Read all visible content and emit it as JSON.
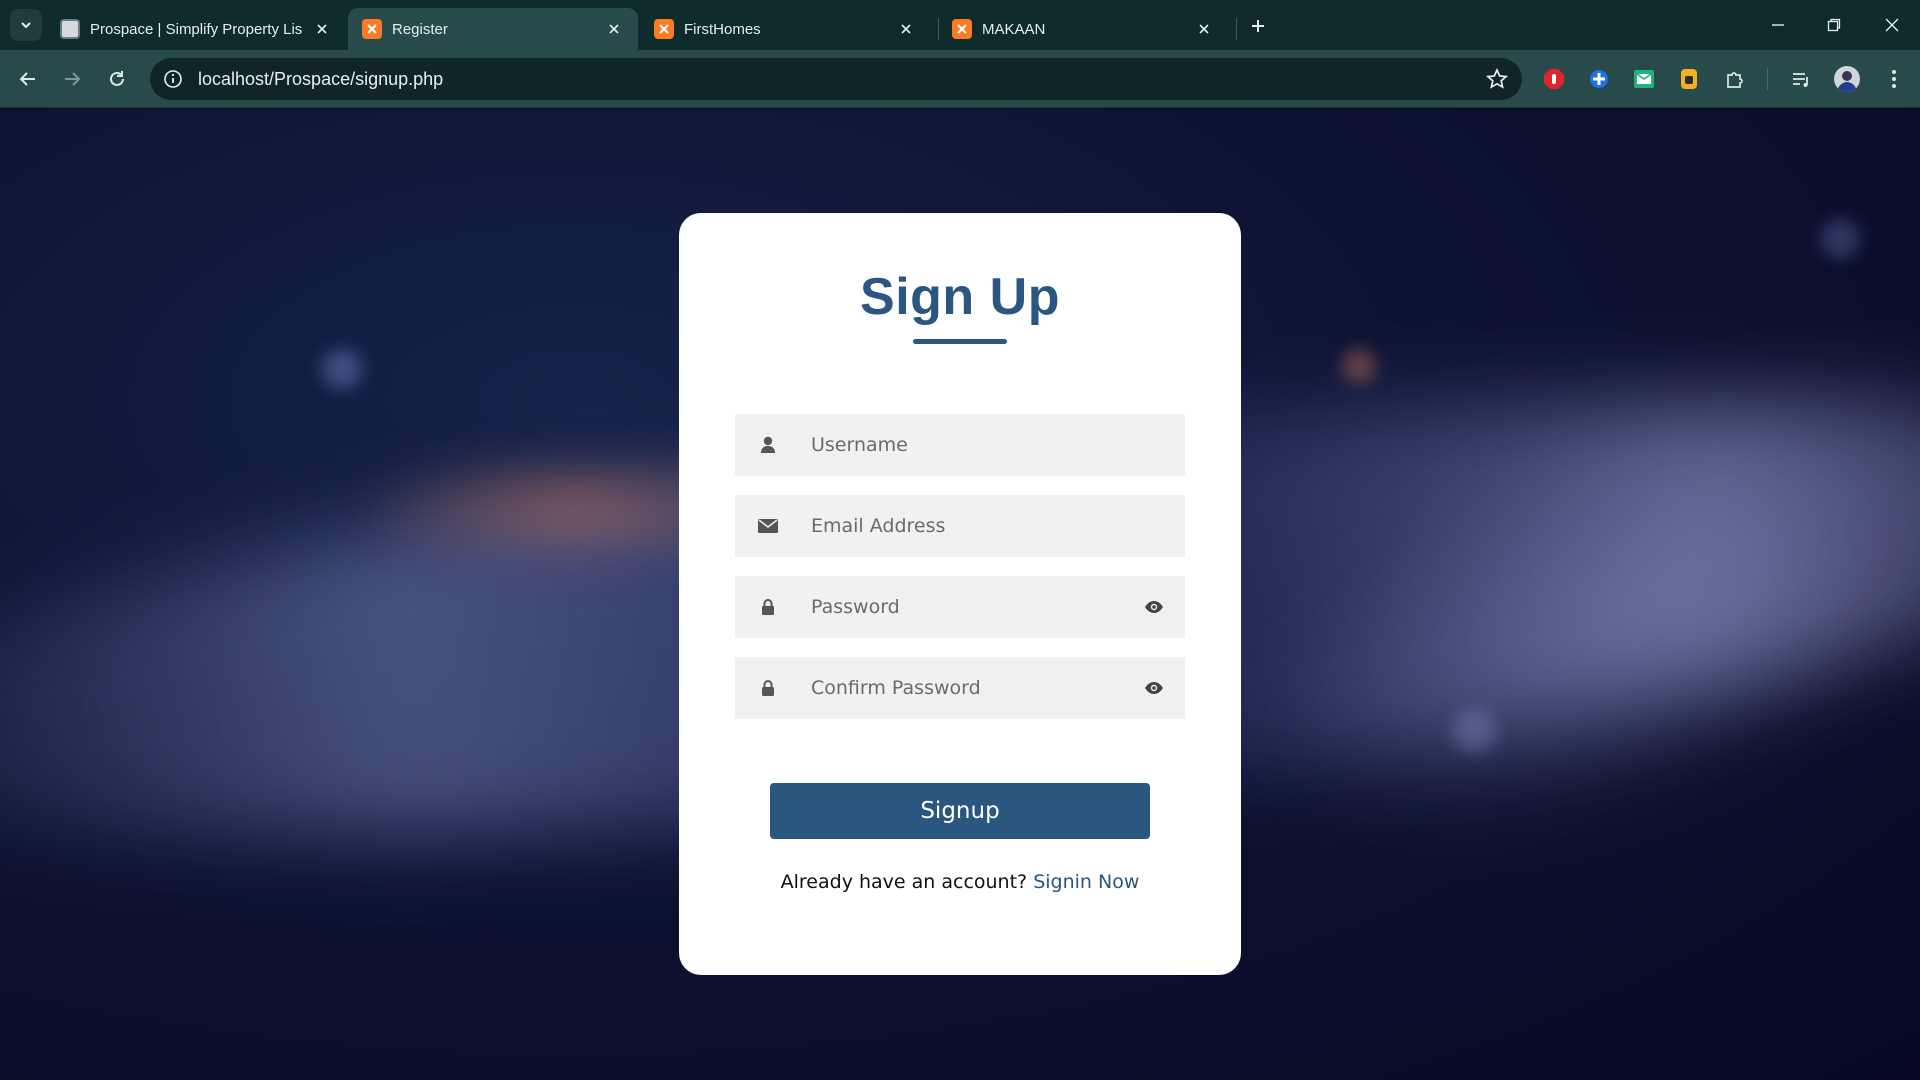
{
  "browser": {
    "tabs": [
      {
        "title": "Prospace | Simplify Property Lis",
        "active": false
      },
      {
        "title": "Register",
        "active": true
      },
      {
        "title": "FirstHomes",
        "active": false
      },
      {
        "title": "MAKAAN",
        "active": false
      }
    ],
    "url": "localhost/Prospace/signup.php",
    "extensions": [
      "stop-icon",
      "puzzle-blue-icon",
      "mail-icon",
      "wallet-icon",
      "extensions-icon"
    ],
    "colors": {
      "frame": "#0e2a2b",
      "toolbar": "#284a4a"
    }
  },
  "signup": {
    "title": "Sign Up",
    "fields": {
      "username_placeholder": "Username",
      "email_placeholder": "Email Address",
      "password_placeholder": "Password",
      "confirm_placeholder": "Confirm Password"
    },
    "submit_label": "Signup",
    "switch_text": "Already have an account?",
    "switch_link": "Signin Now",
    "colors": {
      "accent": "#2b5680",
      "field_bg": "#f1f1f1"
    }
  }
}
